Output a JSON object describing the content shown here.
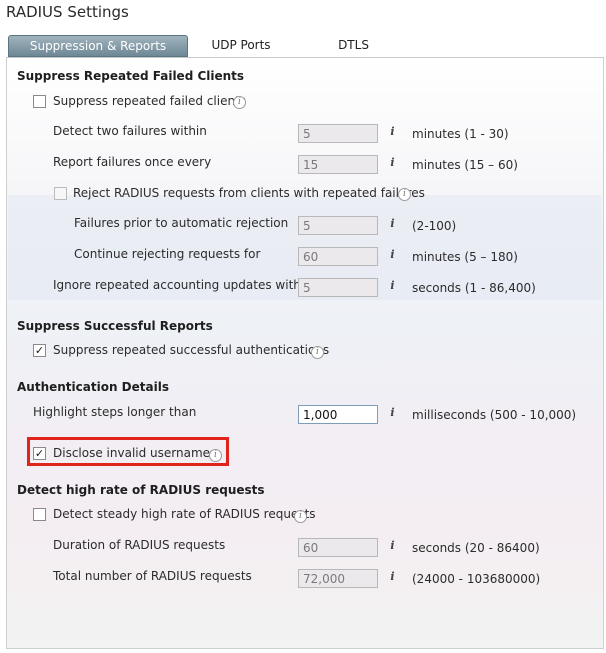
{
  "page": {
    "title": "RADIUS Settings"
  },
  "tabs": [
    {
      "label": "Suppression & Reports",
      "active": true
    },
    {
      "label": "UDP Ports",
      "active": false
    },
    {
      "label": "DTLS",
      "active": false
    }
  ],
  "sections": {
    "repeated_failed": {
      "title": "Suppress Repeated Failed Clients",
      "suppress_checkbox": {
        "label": "Suppress repeated failed clients",
        "checked": false
      },
      "detect_two_failures": {
        "label": "Detect two failures within",
        "value": "5",
        "unit": "minutes (1 - 30)"
      },
      "report_failures": {
        "label": "Report failures once every",
        "value": "15",
        "unit": "minutes (15 – 60)"
      },
      "reject_checkbox": {
        "label": "Reject RADIUS requests from clients with repeated failures",
        "checked": false
      },
      "failures_prior": {
        "label": "Failures prior to automatic rejection",
        "value": "5",
        "unit": "(2-100)"
      },
      "continue_rejecting": {
        "label": "Continue rejecting requests for",
        "value": "60",
        "unit": "minutes (5 – 180)"
      },
      "ignore_accounting": {
        "label": "Ignore repeated accounting updates within",
        "value": "5",
        "unit": "seconds (1 - 86,400)"
      }
    },
    "successful_reports": {
      "title": "Suppress Successful Reports",
      "suppress_success_checkbox": {
        "label": "Suppress repeated successful authentications",
        "checked": true
      }
    },
    "authentication_details": {
      "title": "Authentication Details",
      "highlight_steps": {
        "label": "Highlight steps longer than",
        "value": "1,000",
        "unit": "milliseconds (500 - 10,000)"
      },
      "disclose_checkbox": {
        "label": "Disclose invalid usernames",
        "checked": true
      }
    },
    "high_rate": {
      "title": "Detect high rate of RADIUS requests",
      "detect_checkbox": {
        "label": "Detect steady high rate of RADIUS requests",
        "checked": false
      },
      "duration": {
        "label": "Duration of RADIUS requests",
        "value": "60",
        "unit": "seconds (20 - 86400)"
      },
      "total_number": {
        "label": "Total number of RADIUS requests",
        "value": "72,000",
        "unit": "(24000 - 103680000)"
      }
    }
  },
  "colors": {
    "highlight_box": "#e0241b",
    "active_tab": "#6f8896"
  },
  "icons": {
    "info": "info-icon",
    "check": "checkmark"
  }
}
